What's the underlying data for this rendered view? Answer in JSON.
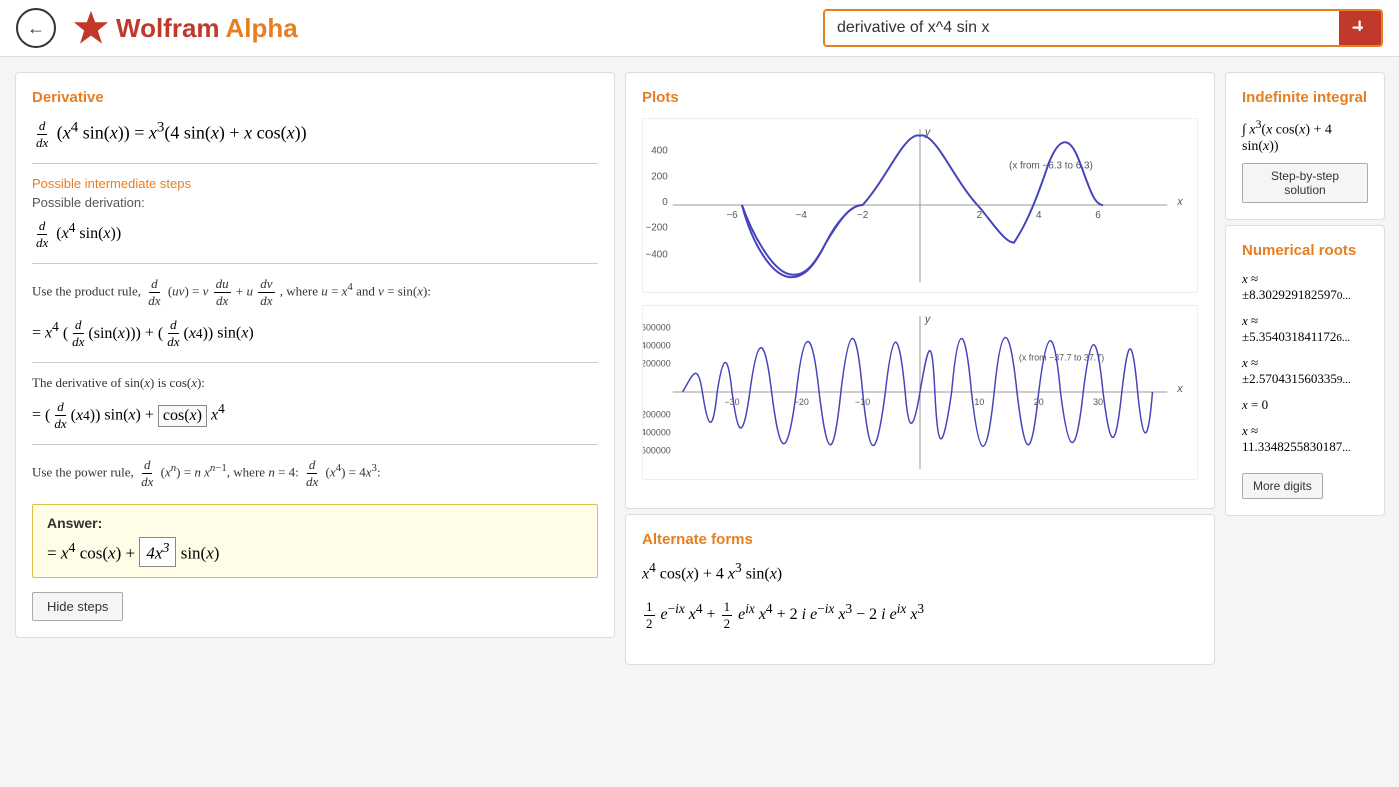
{
  "header": {
    "back_label": "←",
    "logo_wolfram": "Wolfram",
    "logo_alpha": "Alpha",
    "search_value": "derivative of x^4 sin x",
    "search_placeholder": "derivative of x^4 sin x",
    "search_button_label": "="
  },
  "derivative_panel": {
    "title": "Derivative",
    "main_formula": "d/dx (x⁴ sin(x)) = x³(4 sin(x) + x cos(x))",
    "intermediate_steps_link": "Possible intermediate steps",
    "possible_derivation_label": "Possible derivation:",
    "deriv_expression": "d/dx (x⁴ sin(x))",
    "product_rule_text": "Use the product rule, d/dx(uv) = v du/dx + u dv/dx, where u = x⁴ and v = sin(x):",
    "product_step": "= x⁴(d/dx(sin(x))) + (d/dx(x⁴))sin(x)",
    "sin_deriv_text": "The derivative of sin(x) is cos(x):",
    "sin_step": "= (d/dx(x⁴))sin(x) + [cos(x)] x⁴",
    "power_rule_text": "Use the power rule, d/dx(xⁿ) = n xⁿ⁻¹, where n = 4: d/dx(x⁴) = 4x³:",
    "answer_label": "Answer:",
    "answer_formula": "= x⁴ cos(x) + [4x³] sin(x)",
    "hide_steps_label": "Hide steps"
  },
  "plots_panel": {
    "title": "Plots",
    "plot1_range": "(x from −6.3 to 6.3)",
    "plot2_range": "(x from −37.7 to 37.7)"
  },
  "alternate_forms_panel": {
    "title": "Alternate forms",
    "form1": "x⁴ cos(x) + 4 x³ sin(x)",
    "form2": "½ e^(−ix) x⁴ + ½ e^(ix) x⁴ + 2i e^(−ix) x³ − 2i e^(ix) x³"
  },
  "right_panels": {
    "indefinite_integral_title": "Indefinite integral",
    "integral_formula": "∫ x³(x cos(x) + 4 sin(x))",
    "step_solution_label": "Step-by-step solution",
    "numerical_roots_title": "Numerical roots",
    "roots": [
      {
        "value": "x ≈ ±8.30292918259706..."
      },
      {
        "value": "x ≈ ±5.35403184117260..."
      },
      {
        "value": "x ≈ ±2.57043156033590..."
      },
      {
        "value": "x = 0"
      },
      {
        "value": "x ≈ 11.33482558301870..."
      }
    ],
    "more_digits_label": "More digits"
  },
  "colors": {
    "orange": "#e67e22",
    "red": "#c0392b",
    "blue_plot": "#4444bb"
  }
}
